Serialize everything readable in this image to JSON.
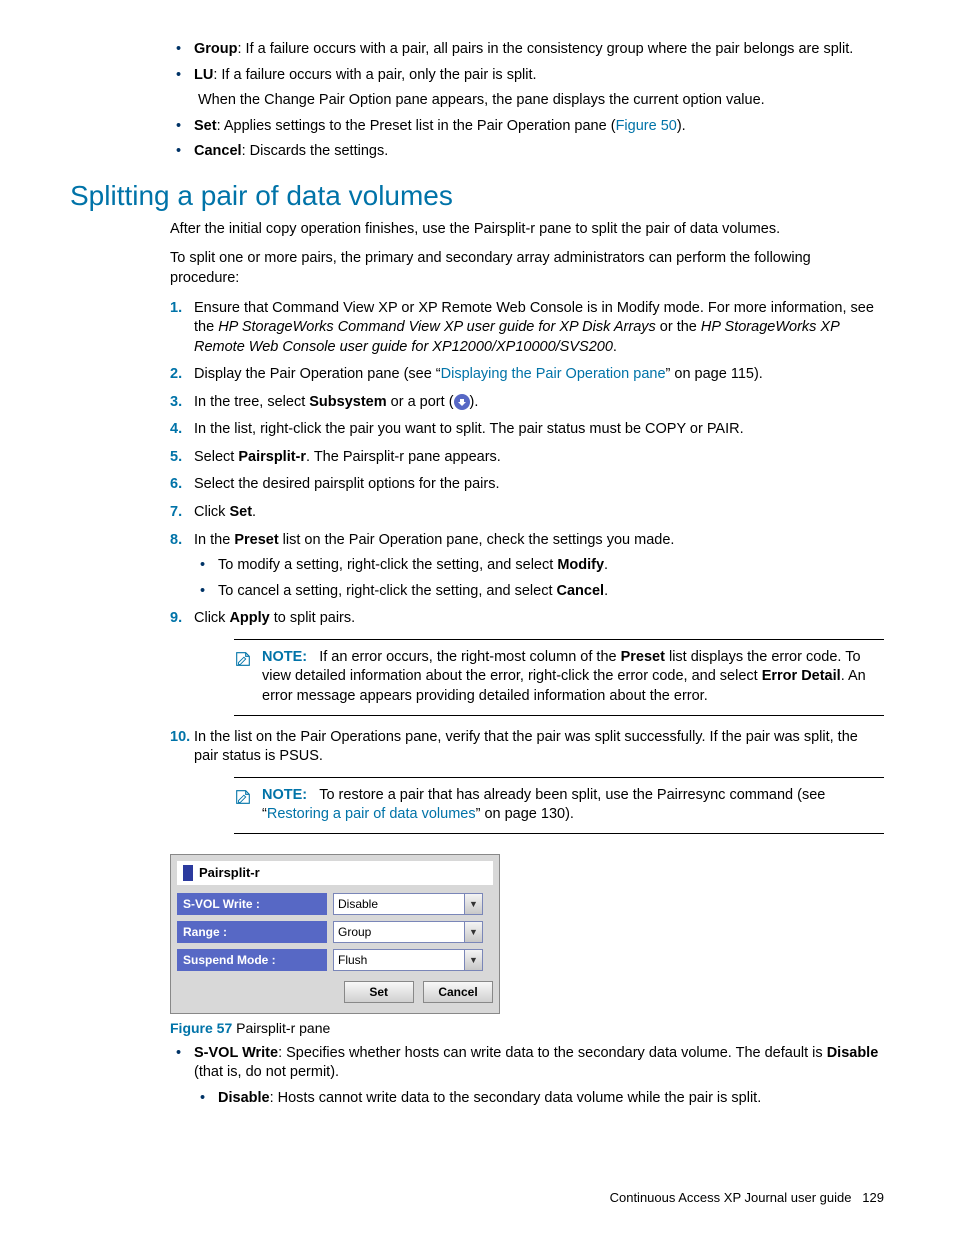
{
  "intro_bullets": {
    "group_label": "Group",
    "group_text": ": If a failure occurs with a pair, all pairs in the consistency group where the pair belongs are split.",
    "lu_label": "LU",
    "lu_text": ": If a failure occurs with a pair, only the pair is split.",
    "when_text": "When the Change Pair Option pane appears, the pane displays the current option value.",
    "set_label": "Set",
    "set_text": ": Applies settings to the Preset list in the Pair Operation pane (",
    "set_link": "Figure 50",
    "set_after": ").",
    "cancel_label": "Cancel",
    "cancel_text": ": Discards the settings."
  },
  "section_title": "Splitting a pair of data volumes",
  "para1": "After the initial copy operation finishes, use the Pairsplit-r pane to split the pair of data volumes.",
  "para2": "To split one or more pairs, the primary and secondary array administrators can perform the following procedure:",
  "steps": {
    "s1a": "Ensure that Command View XP or XP Remote Web Console is in Modify mode. For more information, see the ",
    "s1i1": "HP StorageWorks Command View XP user guide for XP Disk Arrays",
    "s1b": " or the ",
    "s1i2": "HP StorageWorks XP Remote Web Console user guide for XP12000/XP10000/SVS200",
    "s1c": ".",
    "s2a": "Display the Pair Operation pane (see “",
    "s2link": "Displaying the Pair Operation pane",
    "s2b": "” on page 115).",
    "s3a": "In the tree, select ",
    "s3b": "Subsystem",
    "s3c": " or a port (",
    "s3d": ").",
    "s4": "In the list, right-click the pair you want to split. The pair status must be COPY or PAIR.",
    "s5a": "Select ",
    "s5b": "Pairsplit-r",
    "s5c": ". The Pairsplit-r pane appears.",
    "s6": "Select the desired pairsplit options for the pairs.",
    "s7a": "Click ",
    "s7b": "Set",
    "s7c": ".",
    "s8a": "In the ",
    "s8b": "Preset",
    "s8c": " list on the Pair Operation pane, check the settings you made.",
    "s8_sub1a": "To modify a setting, right-click the setting, and select ",
    "s8_sub1b": "Modify",
    "s8_sub1c": ".",
    "s8_sub2a": "To cancel a setting, right-click the setting, and select ",
    "s8_sub2b": "Cancel",
    "s8_sub2c": ".",
    "s9a": "Click ",
    "s9b": "Apply",
    "s9c": " to split pairs.",
    "s10": "In the list on the Pair Operations pane, verify that the pair was split successfully. If the pair was split, the pair status is PSUS."
  },
  "note1": {
    "label": "NOTE:",
    "t1": "If an error occurs, the right-most column of the ",
    "b1": "Preset",
    "t2": " list displays the error code. To view detailed information about the error, right-click the error code, and select ",
    "b2": "Error Detail",
    "t3": ". An error message appears providing detailed information about the error."
  },
  "note2": {
    "label": "NOTE:",
    "t1": "To restore a pair that has already been split, use the Pairresync command (see “",
    "link": "Restoring a pair of data volumes",
    "t2": "” on page 130)."
  },
  "figure": {
    "title": "Pairsplit-r",
    "row1_label": "S-VOL Write :",
    "row1_value": "Disable",
    "row2_label": "Range :",
    "row2_value": "Group",
    "row3_label": "Suspend Mode :",
    "row3_value": "Flush",
    "btn_set": "Set",
    "btn_cancel": "Cancel",
    "caption_label": "Figure 57",
    "caption_text": " Pairsplit-r pane"
  },
  "post_fig": {
    "svol_label": "S-VOL Write",
    "svol_t1": ": Specifies whether hosts can write data to the secondary data volume. The default is ",
    "svol_b": "Disable",
    "svol_t2": " (that is, do not permit).",
    "disable_label": "Disable",
    "disable_text": ": Hosts cannot write data to the secondary data volume while the pair is split."
  },
  "footer": {
    "text": "Continuous Access XP Journal user guide",
    "page": "129"
  }
}
